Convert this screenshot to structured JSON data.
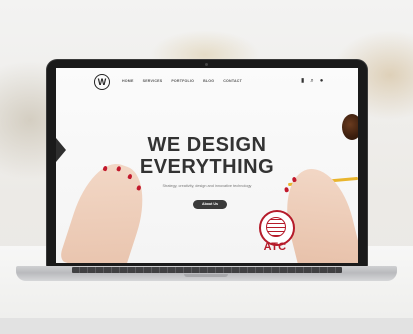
{
  "site": {
    "logo_letter": "W",
    "nav_links": [
      "HOME",
      "SERVICES",
      "PORTFOLIO",
      "BLOG",
      "CONTACT"
    ],
    "nav_icons": [
      "bag-icon",
      "search-icon",
      "user-icon"
    ],
    "hero": {
      "line1": "WE DESIGN",
      "line2": "EVERYTHING",
      "subtitle": "Strategy, creativity, design and innovative technology",
      "button_label": "About Us"
    }
  },
  "badge": {
    "text": "ATC"
  },
  "colors": {
    "brand_red": "#b51b2a",
    "button_dark": "#3a3a3a",
    "laptop_bezel": "#1a1a1a"
  }
}
